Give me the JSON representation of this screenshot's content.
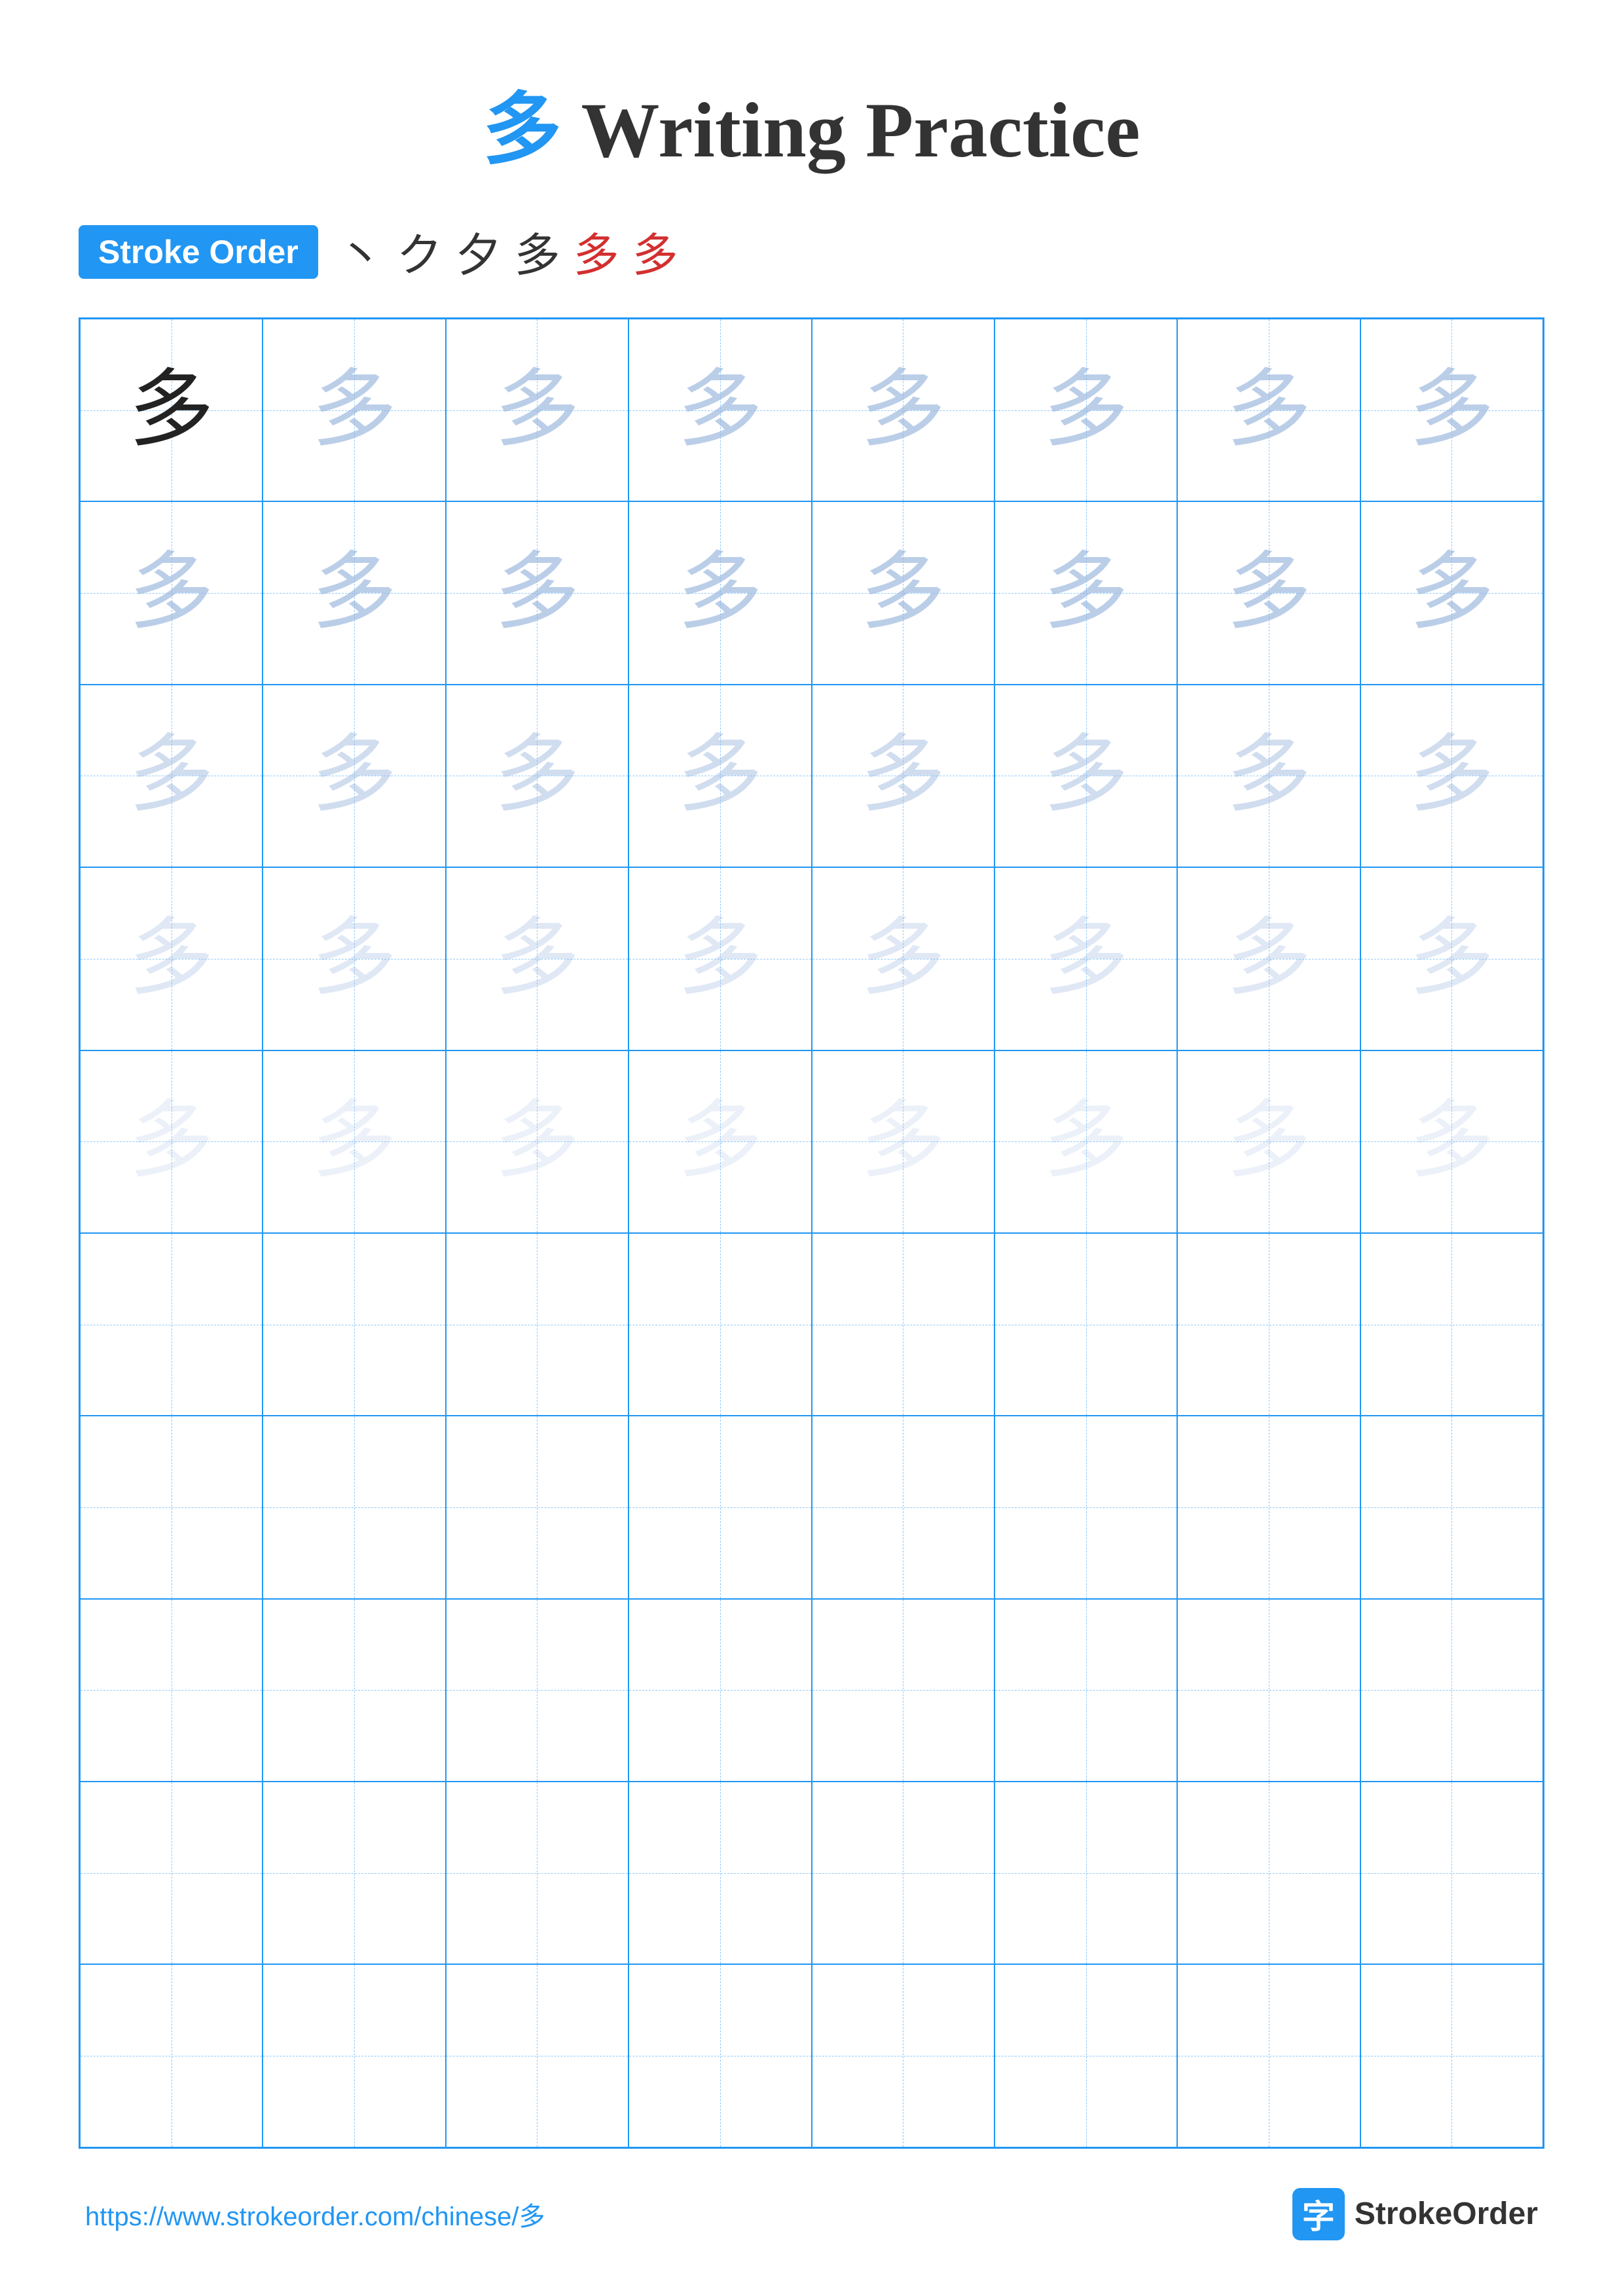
{
  "header": {
    "char": "多",
    "title": "Writing Practice"
  },
  "stroke_order": {
    "badge_label": "Stroke Order",
    "steps": [
      "丶",
      "ク",
      "夕",
      "多",
      "多",
      "多"
    ]
  },
  "grid": {
    "cols": 8,
    "rows": 10,
    "char": "多",
    "filled_rows": 5,
    "empty_rows": 5
  },
  "footer": {
    "url": "https://www.strokeorder.com/chinese/多",
    "logo_char": "字",
    "logo_text": "StrokeOrder"
  }
}
